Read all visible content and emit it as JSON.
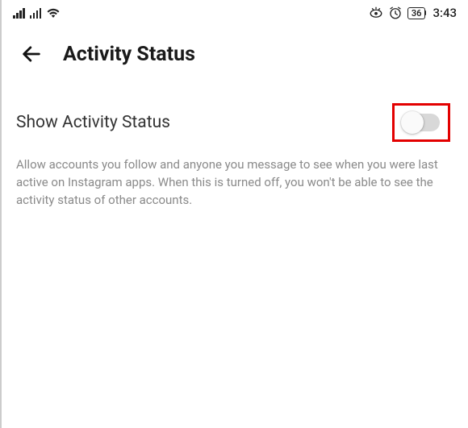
{
  "status_bar": {
    "battery_percent": "36",
    "time": "3:43"
  },
  "header": {
    "title": "Activity Status"
  },
  "setting": {
    "label": "Show Activity Status",
    "description": "Allow accounts you follow and anyone you message to see when you were last active on Instagram apps. When this is turned off, you won't be able to see the activity status of other accounts."
  }
}
